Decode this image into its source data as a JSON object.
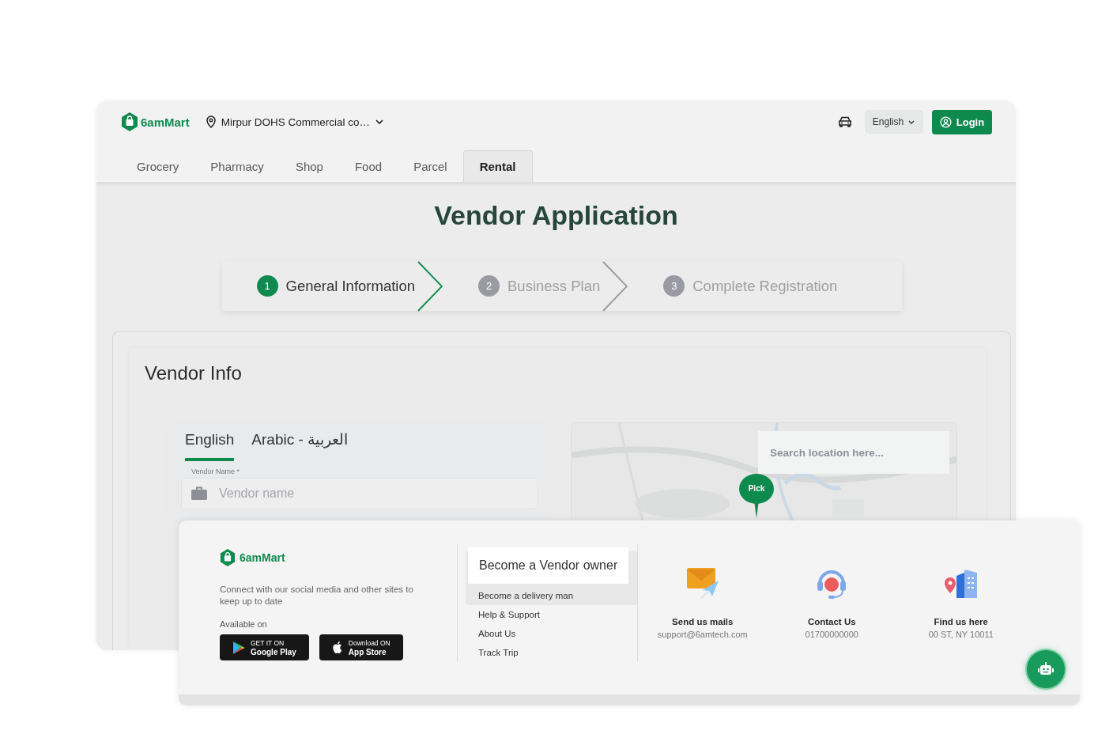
{
  "header": {
    "brand": "6amMart",
    "location": "Mirpur DOHS Commercial co…",
    "language": "English",
    "login": "Login"
  },
  "nav_tabs": [
    {
      "label": "Grocery",
      "selected": false
    },
    {
      "label": "Pharmacy",
      "selected": false
    },
    {
      "label": "Shop",
      "selected": false
    },
    {
      "label": "Food",
      "selected": false
    },
    {
      "label": "Parcel",
      "selected": false
    },
    {
      "label": "Rental",
      "selected": true
    }
  ],
  "page_title": "Vendor Application",
  "steps": [
    {
      "number": "1",
      "label": "General Information",
      "selected": true
    },
    {
      "number": "2",
      "label": "Business Plan",
      "selected": false
    },
    {
      "number": "3",
      "label": "Complete Registration",
      "selected": false
    }
  ],
  "vendor_info": {
    "title": "Vendor Info",
    "language_tabs": [
      {
        "label": "English",
        "selected": true
      },
      {
        "label": "Arabic - العربية",
        "selected": false
      }
    ],
    "vendor_name": {
      "label": "Vendor Name *",
      "placeholder": "Vendor name"
    },
    "map": {
      "kind": "picture",
      "search_placeholder": "Search location here...",
      "pin": "Pick"
    }
  },
  "footer": {
    "brand": "6amMart",
    "tagline": "Connect with our social media and other sites to keep up to date",
    "available_on": "Available on",
    "stores": [
      {
        "kind": "google",
        "line1": "GET IT ON",
        "line2": "Google Play"
      },
      {
        "kind": "apple",
        "line1": "Download ON",
        "line2": "App Store"
      }
    ],
    "links": [
      {
        "label": "Become a Vendor owner",
        "selected": true
      },
      {
        "label": "Become a delivery man",
        "selected": false
      },
      {
        "label": "Help & Support",
        "selected": false
      },
      {
        "label": "About Us",
        "selected": false
      },
      {
        "label": "Track Trip",
        "selected": false
      }
    ],
    "contacts": [
      {
        "kind": "mail",
        "title": "Send us mails",
        "value": "support@6amtech.com"
      },
      {
        "kind": "phone",
        "title": "Contact Us",
        "value": "01700000000"
      },
      {
        "kind": "address",
        "title": "Find us here",
        "value": "00 ST, NY 10011"
      }
    ]
  }
}
